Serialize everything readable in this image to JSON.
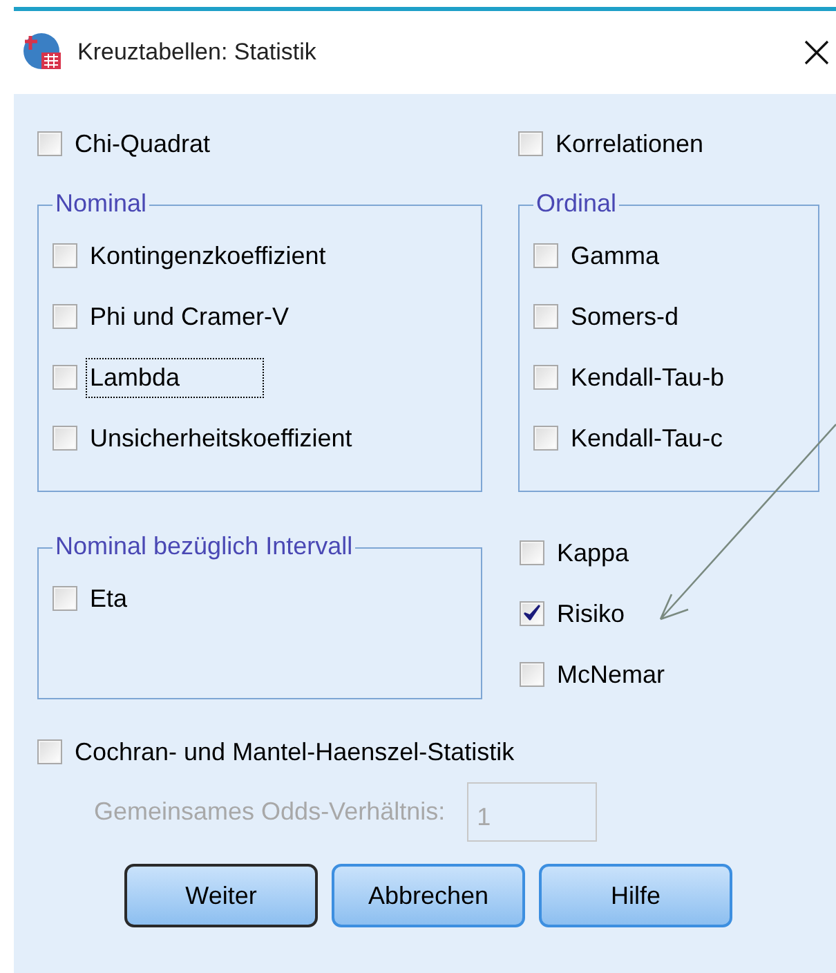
{
  "window": {
    "title": "Kreuztabellen: Statistik"
  },
  "top_options": [
    {
      "label": "Chi-Quadrat",
      "checked": false
    },
    {
      "label": "Korrelationen",
      "checked": false
    }
  ],
  "nominal": {
    "title": "Nominal",
    "items": [
      {
        "label": "Kontingenzkoeffizient",
        "checked": false,
        "focused": false
      },
      {
        "label": "Phi und Cramer-V",
        "checked": false,
        "focused": false
      },
      {
        "label": "Lambda",
        "checked": false,
        "focused": true
      },
      {
        "label": "Unsicherheitskoeffizient",
        "checked": false,
        "focused": false
      }
    ]
  },
  "ordinal": {
    "title": "Ordinal",
    "items": [
      {
        "label": "Gamma",
        "checked": false
      },
      {
        "label": "Somers-d",
        "checked": false
      },
      {
        "label": "Kendall-Tau-b",
        "checked": false
      },
      {
        "label": "Kendall-Tau-c",
        "checked": false
      }
    ]
  },
  "nominal_interval": {
    "title": "Nominal bezüglich Intervall",
    "items": [
      {
        "label": "Eta",
        "checked": false
      }
    ]
  },
  "other_options": [
    {
      "label": "Kappa",
      "checked": false
    },
    {
      "label": "Risiko",
      "checked": true
    },
    {
      "label": "McNemar",
      "checked": false
    }
  ],
  "cochran": {
    "label": "Cochran- und Mantel-Haenszel-Statistik",
    "checked": false
  },
  "odds_ratio": {
    "label": "Gemeinsames Odds-Verhältnis:",
    "value": "1",
    "disabled": true
  },
  "buttons": [
    {
      "label": "Weiter",
      "default": true
    },
    {
      "label": "Abbrechen",
      "default": false
    },
    {
      "label": "Hilfe",
      "default": false
    }
  ]
}
